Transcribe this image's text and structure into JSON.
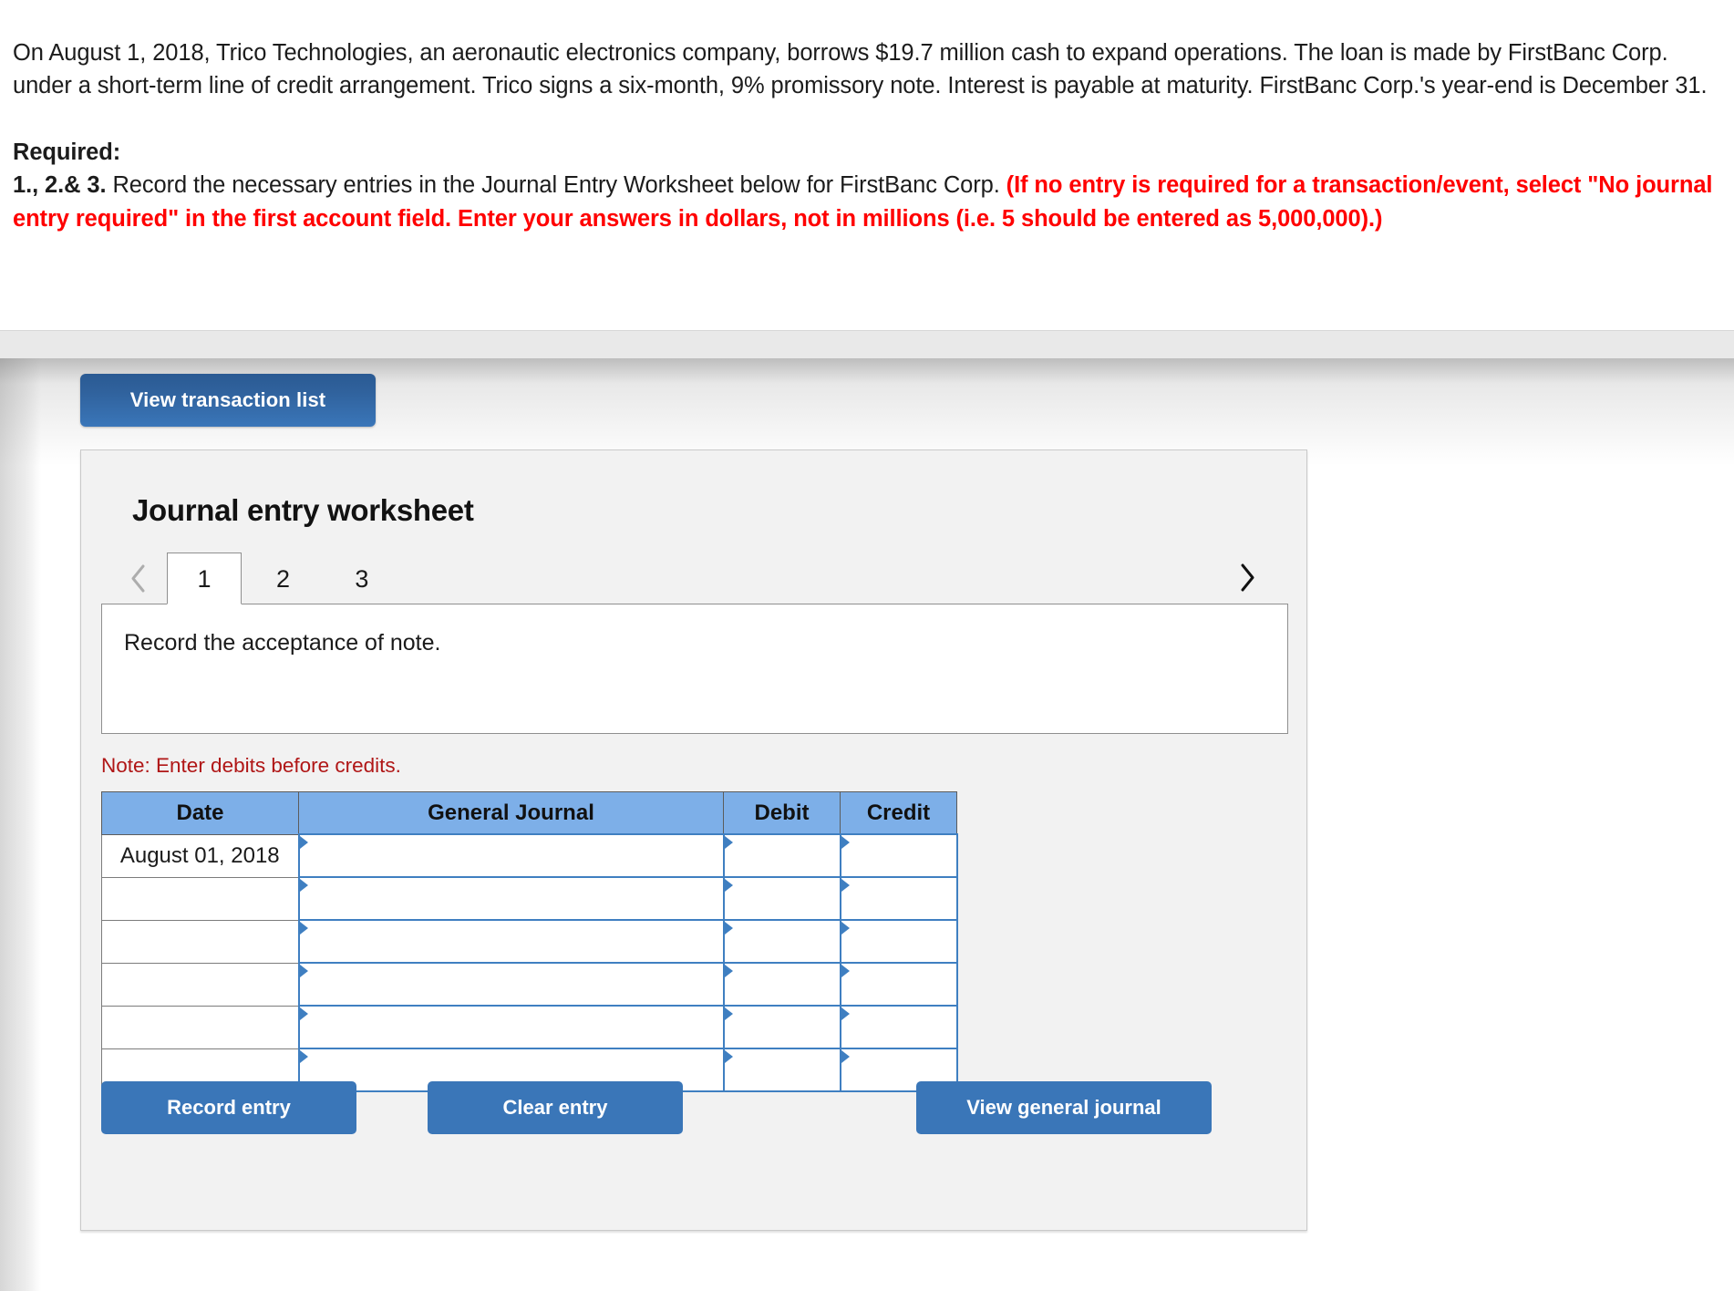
{
  "problem": {
    "statement": "On August 1, 2018, Trico Technologies, an aeronautic electronics company, borrows $19.7 million cash to expand operations. The loan is made by FirstBanc Corp. under a short-term line of credit arrangement. Trico signs a six-month, 9% promissory note. Interest is payable at maturity. FirstBanc Corp.'s year-end is December 31.",
    "required_label": "Required:",
    "required_number": "1., 2.& 3.",
    "required_black": " Record the necessary entries in the Journal Entry Worksheet below for FirstBanc Corp. ",
    "required_red": "(If no entry is required for a transaction/event, select \"No journal entry required\" in the first account field. Enter your answers in dollars, not in millions (i.e. 5 should be entered as 5,000,000).)"
  },
  "toolbar": {
    "view_transaction_list_label": "View transaction list"
  },
  "worksheet": {
    "title": "Journal entry worksheet",
    "tabs": [
      {
        "label": "1",
        "active": true
      },
      {
        "label": "2",
        "active": false
      },
      {
        "label": "3",
        "active": false
      }
    ],
    "prev_icon": "chevron-left-icon",
    "next_icon": "chevron-right-icon",
    "description": "Record the acceptance of note.",
    "note": "Note: Enter debits before credits."
  },
  "journal_table": {
    "columns": [
      "Date",
      "General Journal",
      "Debit",
      "Credit"
    ],
    "rows": [
      {
        "date": "August 01, 2018",
        "general_journal": "",
        "debit": "",
        "credit": ""
      },
      {
        "date": "",
        "general_journal": "",
        "debit": "",
        "credit": ""
      },
      {
        "date": "",
        "general_journal": "",
        "debit": "",
        "credit": ""
      },
      {
        "date": "",
        "general_journal": "",
        "debit": "",
        "credit": ""
      },
      {
        "date": "",
        "general_journal": "",
        "debit": "",
        "credit": ""
      },
      {
        "date": "",
        "general_journal": "",
        "debit": "",
        "credit": ""
      }
    ]
  },
  "actions": {
    "record_entry_label": "Record entry",
    "clear_entry_label": "Clear entry",
    "view_general_journal_label": "View general journal"
  },
  "colors": {
    "accent_blue": "#3a76b8",
    "table_header_blue": "#7dafe8",
    "input_border_blue": "#3f7fc1",
    "warning_red": "#b01616",
    "required_red": "#ff0000",
    "panel_bg": "#f2f2f2",
    "panel_border": "#c9c9c9"
  }
}
